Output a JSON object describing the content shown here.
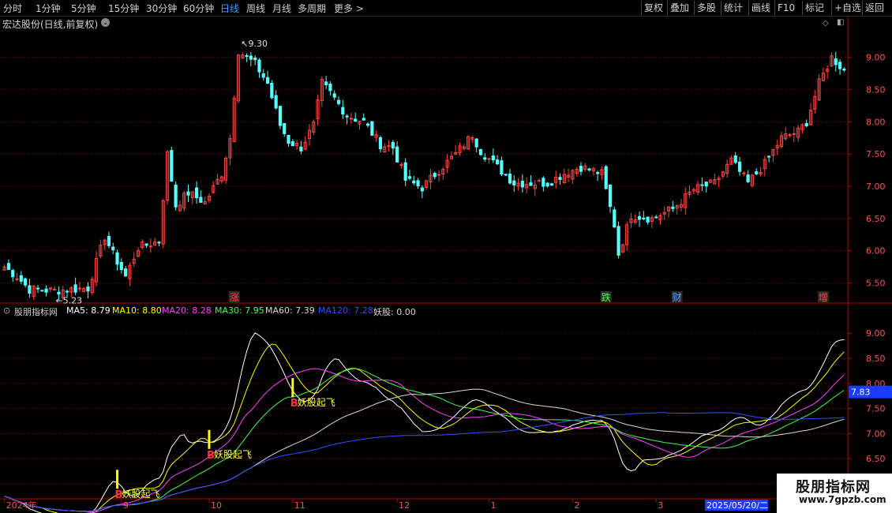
{
  "toolbar": {
    "periods": [
      "分时",
      "1分钟",
      "5分钟",
      "15分钟",
      "30分钟",
      "60分钟",
      "日线",
      "周线",
      "月线",
      "多周期",
      "更多 >"
    ],
    "active_period": "日线",
    "right_buttons": [
      "复权",
      "叠加",
      "多股",
      "统计",
      "画线",
      "F10",
      "标记",
      "+自选",
      "返回"
    ]
  },
  "stock": {
    "title": "宏达股份(日线,前复权)"
  },
  "colors": {
    "up": "#ff4040",
    "down": "#54ffff",
    "ma5": "#ffffff",
    "ma10": "#ffff00",
    "ma20": "#ff40ff",
    "ma30": "#40ff40",
    "ma60": "#d8d8d8",
    "ma120": "#3050ff",
    "grid": "#6a0000",
    "axis": "#ffffff",
    "box": "#b00000"
  },
  "chart_data": [
    {
      "type": "candlestick",
      "ylim": [
        5.2,
        9.45
      ],
      "yticks": [
        "9.00",
        "8.50",
        "8.00",
        "7.50",
        "7.00",
        "6.50",
        "6.00",
        "5.50"
      ],
      "max_label": "9.30",
      "min_label": "5.23",
      "event_markers": [
        {
          "label": "涨",
          "index": 55,
          "color": "#ff4040"
        },
        {
          "label": "跌",
          "index": 144,
          "color": "#40ff40"
        },
        {
          "label": "财",
          "index": 161,
          "color": "#54a0ff"
        },
        {
          "label": "增",
          "index": 196,
          "color": "#ff4040"
        }
      ],
      "x_index_range": [
        0,
        201
      ],
      "anchors": [
        [
          0,
          5.75
        ],
        [
          3,
          5.6
        ],
        [
          6,
          5.4
        ],
        [
          12,
          5.38
        ],
        [
          20,
          5.42
        ],
        [
          24,
          6.22
        ],
        [
          26,
          5.95
        ],
        [
          29,
          5.6
        ],
        [
          32,
          6.05
        ],
        [
          37,
          6.15
        ],
        [
          39,
          7.5
        ],
        [
          41,
          6.7
        ],
        [
          44,
          6.9
        ],
        [
          48,
          6.75
        ],
        [
          52,
          7.2
        ],
        [
          54,
          7.75
        ],
        [
          56,
          9.1
        ],
        [
          60,
          8.9
        ],
        [
          63,
          8.6
        ],
        [
          66,
          7.95
        ],
        [
          68,
          7.7
        ],
        [
          71,
          7.6
        ],
        [
          74,
          7.95
        ],
        [
          76,
          8.6
        ],
        [
          78,
          8.45
        ],
        [
          82,
          8.1
        ],
        [
          86,
          8.0
        ],
        [
          90,
          7.65
        ],
        [
          93,
          7.6
        ],
        [
          96,
          7.1
        ],
        [
          100,
          6.98
        ],
        [
          104,
          7.25
        ],
        [
          108,
          7.5
        ],
        [
          112,
          7.8
        ],
        [
          114,
          7.55
        ],
        [
          118,
          7.3
        ],
        [
          122,
          7.05
        ],
        [
          130,
          7.05
        ],
        [
          134,
          7.2
        ],
        [
          138,
          7.3
        ],
        [
          143,
          7.2
        ],
        [
          146,
          6.4
        ],
        [
          147,
          5.95
        ],
        [
          150,
          6.55
        ],
        [
          155,
          6.5
        ],
        [
          160,
          6.65
        ],
        [
          165,
          6.95
        ],
        [
          170,
          7.05
        ],
        [
          174,
          7.4
        ],
        [
          178,
          7.05
        ],
        [
          182,
          7.35
        ],
        [
          186,
          7.75
        ],
        [
          190,
          7.85
        ],
        [
          192,
          8.0
        ],
        [
          195,
          8.6
        ],
        [
          198,
          9.0
        ],
        [
          201,
          8.8
        ]
      ]
    },
    {
      "type": "line",
      "title": "股朋指标网",
      "ylim": [
        5.7,
        9.35
      ],
      "yticks": [
        "9.00",
        "8.50",
        "8.00",
        "7.50",
        "7.00",
        "6.50",
        "6.00"
      ],
      "current_value_box": "7.83",
      "series": [
        {
          "name": "MA5",
          "value": "8.79",
          "smooth": 5,
          "color": "#ffffff"
        },
        {
          "name": "MA10",
          "value": "8.80",
          "smooth": 10,
          "color": "#ffff00"
        },
        {
          "name": "MA20",
          "value": "8.28",
          "smooth": 20,
          "color": "#ff40ff"
        },
        {
          "name": "MA30",
          "value": "7.95",
          "smooth": 30,
          "color": "#40ff40"
        },
        {
          "name": "MA60",
          "value": "7.39",
          "smooth": 60,
          "color": "#d8d8d8"
        },
        {
          "name": "MA120",
          "value": "7.28",
          "smooth": 120,
          "color": "#3050ff"
        },
        {
          "name": "妖股",
          "value": "0.00",
          "color": "#d8d8d8"
        }
      ],
      "signals": [
        {
          "index": 27,
          "label": "妖股起飞",
          "marker": "B"
        },
        {
          "index": 49,
          "label": "妖股起飞",
          "marker": "B"
        },
        {
          "index": 69,
          "label": "妖股起飞",
          "marker": "B"
        }
      ],
      "x_tick_labels": [
        {
          "label": "2024年",
          "index": 0
        },
        {
          "label": "9",
          "index": 28
        },
        {
          "label": "10",
          "index": 49
        },
        {
          "label": "11",
          "index": 69
        },
        {
          "label": "12",
          "index": 94
        },
        {
          "label": "1",
          "index": 116
        },
        {
          "label": "2",
          "index": 136
        },
        {
          "label": "3",
          "index": 156
        },
        {
          "label": "4",
          "index": 180
        },
        {
          "label": "5",
          "index": 201
        },
        {
          "label": "2025/05/20/二",
          "index": 213
        }
      ]
    }
  ],
  "watermark": {
    "title": "股朋指标网",
    "url": "www.7gpzb.com"
  }
}
